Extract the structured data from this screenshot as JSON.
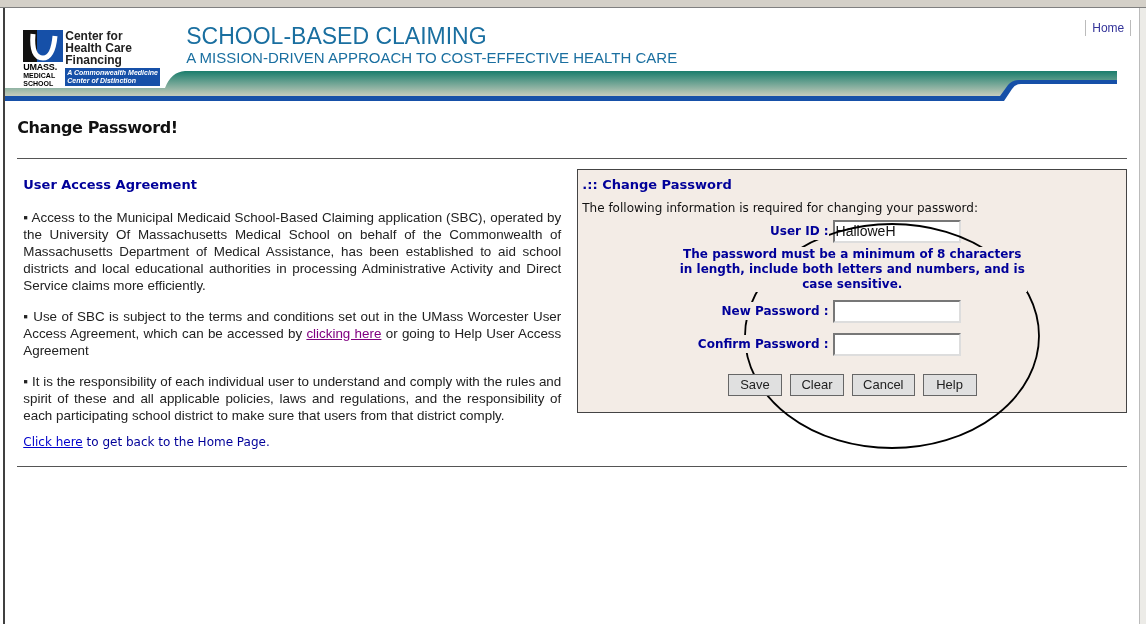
{
  "header": {
    "logo": {
      "name_lines": [
        "Center for",
        "Health Care",
        "Financing"
      ],
      "university": "UMASS.",
      "school_lines": [
        "MEDICAL",
        "SCHOOL"
      ],
      "tagline_lines": [
        "A Commonwealth Medicine",
        "Center of Distinction"
      ]
    },
    "title": "SCHOOL-BASED CLAIMING",
    "subtitle": "A MISSION-DRIVEN APPROACH TO COST-EFFECTIVE HEALTH CARE",
    "nav": [
      "Home"
    ]
  },
  "page_title": "Change Password!",
  "agreement": {
    "heading": "User Access Agreement",
    "paragraphs": [
      {
        "parts": [
          {
            "text": "▪ Access to the Municipal Medicaid School-Based Claiming application (SBC), operated by the University Of Massachusetts Medical School on behalf of the Commonwealth of Massachusetts Department of Medical Assistance, has been established to aid school districts and local educational authorities in processing Administrative Activity and Direct Service claims more efficiently.",
            "link": false
          }
        ]
      },
      {
        "parts": [
          {
            "text": "▪ Use of SBC is subject to the terms and conditions set out in the UMass Worcester User Access Agreement, which can be accessed by ",
            "link": false
          },
          {
            "text": "clicking here",
            "link": true,
            "visited": true
          },
          {
            "text": " or going to Help User Access Agreement",
            "link": false
          }
        ]
      },
      {
        "parts": [
          {
            "text": "▪ It is the responsibility of each individual user to understand and comply with the rules and spirit of these and all applicable policies, laws and regulations, and the responsibility of each participating school district to make sure that users from that district comply.",
            "link": false
          }
        ]
      }
    ],
    "home_line": {
      "link": "Click here",
      "rest": " to get back to the Home Page."
    }
  },
  "form": {
    "title": ".:: Change Password",
    "intro": "The following information is required for changing your password:",
    "fields": [
      {
        "label": "User ID :",
        "value": "HalloweH"
      }
    ],
    "rule": "The password must be a minimum of 8 characters in length, include both letters and numbers, and is case sensitive.",
    "password_fields": [
      {
        "label": "New Password :"
      },
      {
        "label": "Confirm Password :"
      }
    ],
    "buttons": [
      "Save",
      "Clear",
      "Cancel",
      "Help"
    ]
  }
}
